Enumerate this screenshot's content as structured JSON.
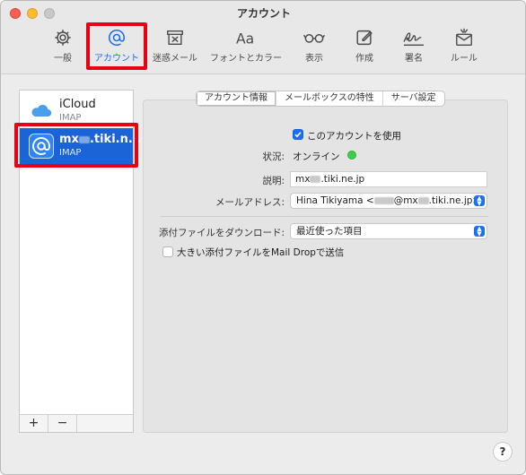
{
  "window": {
    "title": "アカウント"
  },
  "toolbar": {
    "items": [
      {
        "label": "一般",
        "icon": "gear-icon"
      },
      {
        "label": "アカウント",
        "icon": "at-icon"
      },
      {
        "label": "迷惑メール",
        "icon": "junk-icon"
      },
      {
        "label": "フォントとカラー",
        "icon": "fonts-icon"
      },
      {
        "label": "表示",
        "icon": "glasses-icon"
      },
      {
        "label": "作成",
        "icon": "compose-icon"
      },
      {
        "label": "署名",
        "icon": "signature-icon"
      },
      {
        "label": "ルール",
        "icon": "rules-icon"
      }
    ],
    "active_index": 1
  },
  "accounts": [
    {
      "name": "iCloud",
      "type": "IMAP",
      "icon": "icloud-icon"
    },
    {
      "name_prefix": "mx",
      "name_suffix": ".tiki.n...",
      "type": "IMAP",
      "icon": "at-mail-icon",
      "selected": true
    }
  ],
  "sidebar_footer": {
    "add_label": "+",
    "remove_label": "−"
  },
  "tabs": [
    {
      "label": "アカウント情報",
      "selected": true
    },
    {
      "label": "メールボックスの特性"
    },
    {
      "label": "サーバ設定"
    }
  ],
  "form": {
    "enable_label": "このアカウントを使用",
    "enable_checked": true,
    "status_label": "状況:",
    "status_value": "オンライン",
    "description_label": "説明:",
    "description_prefix": "mx",
    "description_suffix": ".tiki.ne.jp",
    "email_label": "メールアドレス:",
    "email_name": "Hina Tikiyama <",
    "email_mid": "@mx",
    "email_suffix": ".tiki.ne.jp>",
    "download_label": "添付ファイルをダウンロード:",
    "download_value": "最近使った項目",
    "maildrop_label": "大きい添付ファイルをMail Dropで送信",
    "maildrop_checked": false
  },
  "help_label": "?",
  "colors": {
    "accent": "#1a6ff5",
    "selection": "#1a64d8",
    "highlight_box": "#e60012",
    "online": "#3ccf4e"
  }
}
